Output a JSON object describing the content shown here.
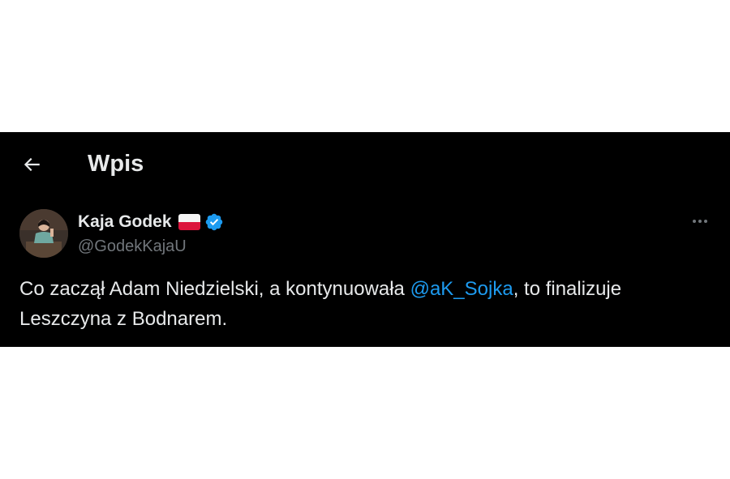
{
  "header": {
    "title": "Wpis",
    "back_icon": "arrow-left-icon"
  },
  "post": {
    "author": {
      "display_name": "Kaja Godek",
      "handle": "@GodekKajaU",
      "flag_icon": "poland-flag-icon",
      "verified_icon": "verified-badge-icon",
      "verified_color": "#1d9bf0"
    },
    "more_icon": "more-horizontal-icon",
    "text_part1": "Co zaczął Adam Niedzielski, a kontynuowała ",
    "mention": "@aK_Sojka",
    "text_part2": ", to finalizuje Leszczyna z Bodnarem."
  },
  "colors": {
    "background": "#000000",
    "text": "#e7e9ea",
    "secondary_text": "#71767b",
    "link": "#1d9bf0"
  }
}
